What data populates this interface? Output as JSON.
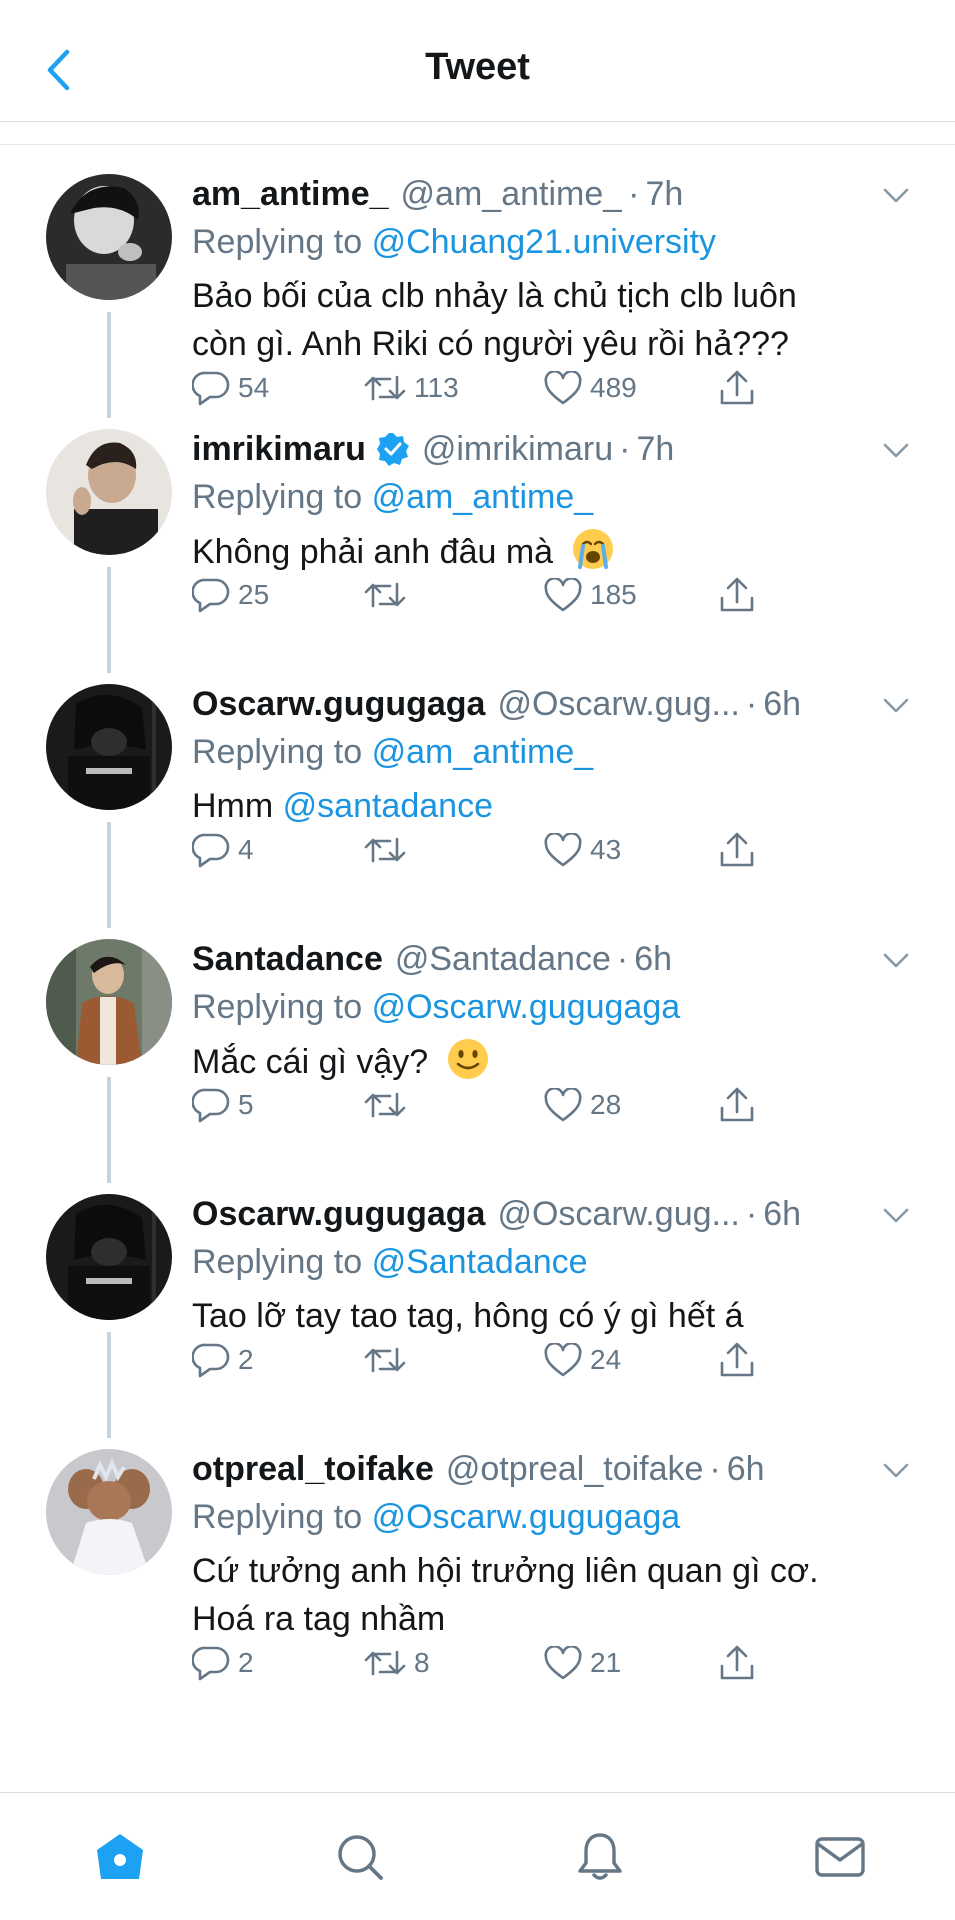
{
  "header": {
    "title": "Tweet",
    "back_icon": "back-chevron-icon"
  },
  "colors": {
    "link": "#1b95e0",
    "muted": "#657786",
    "text": "#14171a",
    "thread_line": "#c4d3de",
    "verified": "#1da1f2"
  },
  "tweets": [
    {
      "name": "am_antime_",
      "verified": false,
      "handle": "@am_antime_",
      "time": "7h",
      "reply_prefix": "Replying to",
      "reply_to": "@Chuang21.university",
      "text_1": "Bảo bối của clb nhảy là chủ tịch clb luôn",
      "text_2": "còn gì. Anh Riki có người yêu rồi hả???",
      "replies": "54",
      "retweets": "113",
      "likes": "489"
    },
    {
      "name": "imrikimaru",
      "verified": true,
      "handle": "@imrikimaru",
      "time": "7h",
      "reply_prefix": "Replying to",
      "reply_to": "@am_antime_",
      "text_1": "Không phải anh đâu mà",
      "emoji": "loudly-crying-face-emoji",
      "replies": "25",
      "retweets": "",
      "likes": "185"
    },
    {
      "name": "Oscarw.gugugaga",
      "verified": false,
      "handle": "@Oscarw.gug...",
      "time": "6h",
      "reply_prefix": "Replying to",
      "reply_to": "@am_antime_",
      "text_1": "Hmm",
      "mention": "@santadance",
      "replies": "4",
      "retweets": "",
      "likes": "43"
    },
    {
      "name": "Santadance",
      "verified": false,
      "handle": "@Santadance",
      "time": "6h",
      "reply_prefix": "Replying to",
      "reply_to": "@Oscarw.gugugaga",
      "text_1": "Mắc cái gì vậy?",
      "emoji": "slightly-smiling-face-emoji",
      "replies": "5",
      "retweets": "",
      "likes": "28"
    },
    {
      "name": "Oscarw.gugugaga",
      "verified": false,
      "handle": "@Oscarw.gug...",
      "time": "6h",
      "reply_prefix": "Replying to",
      "reply_to": "@Santadance",
      "text_1": "Tao lỡ tay tao tag, hông có ý gì hết á",
      "replies": "2",
      "retweets": "",
      "likes": "24"
    },
    {
      "name": "otpreal_toifake",
      "verified": false,
      "handle": "@otpreal_toifake",
      "time": "6h",
      "reply_prefix": "Replying to",
      "reply_to": "@Oscarw.gugugaga",
      "text_1": "Cứ tưởng anh hội trưởng liên quan gì cơ.",
      "text_2": "Hoá ra tag nhầm",
      "replies": "2",
      "retweets": "8",
      "likes": "21"
    }
  ],
  "tabbar": {
    "tabs": [
      "home-icon",
      "search-icon",
      "notifications-bell-icon",
      "messages-envelope-icon"
    ]
  }
}
